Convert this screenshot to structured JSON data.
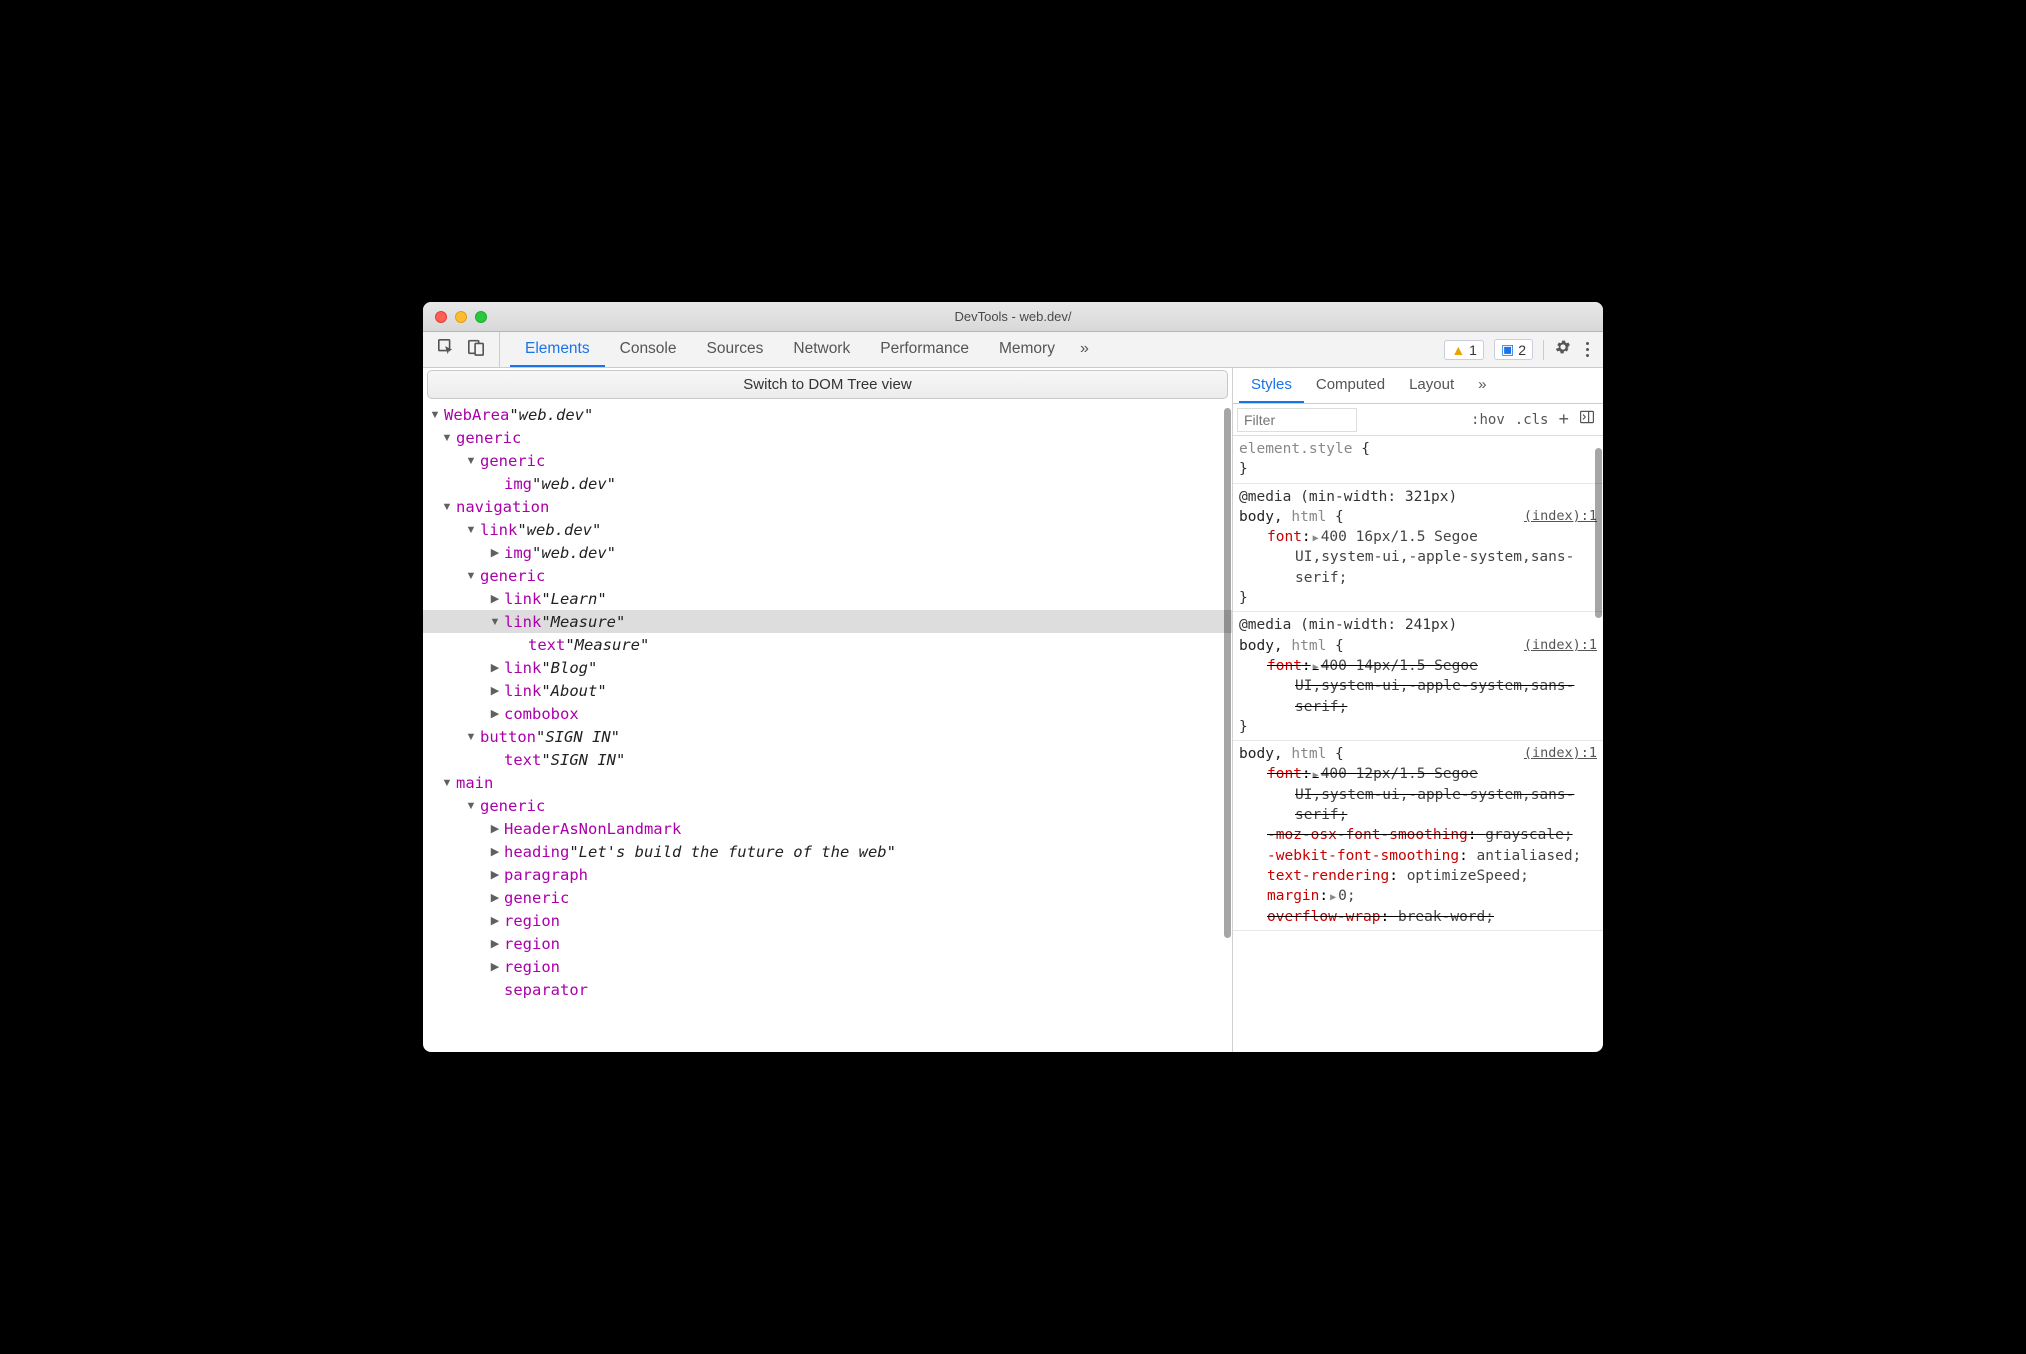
{
  "window": {
    "title": "DevTools - web.dev/"
  },
  "toolbar": {
    "tabs": [
      "Elements",
      "Console",
      "Sources",
      "Network",
      "Performance",
      "Memory"
    ],
    "more": "»",
    "warnings": "1",
    "messages": "2"
  },
  "switchBar": "Switch to DOM Tree view",
  "tree": [
    {
      "indent": 0,
      "arrow": "down",
      "role": "WebArea",
      "name": "web.dev"
    },
    {
      "indent": 1,
      "arrow": "down",
      "role": "generic"
    },
    {
      "indent": 2,
      "arrow": "down",
      "role": "generic"
    },
    {
      "indent": 3,
      "arrow": "none",
      "role": "img",
      "name": "web.dev"
    },
    {
      "indent": 1,
      "arrow": "down",
      "role": "navigation"
    },
    {
      "indent": 2,
      "arrow": "down",
      "role": "link",
      "name": "web.dev"
    },
    {
      "indent": 3,
      "arrow": "right",
      "role": "img",
      "name": "web.dev"
    },
    {
      "indent": 2,
      "arrow": "down",
      "role": "generic"
    },
    {
      "indent": 3,
      "arrow": "right",
      "role": "link",
      "name": "Learn"
    },
    {
      "indent": 3,
      "arrow": "down",
      "role": "link",
      "name": "Measure",
      "selected": true
    },
    {
      "indent": 4,
      "arrow": "none",
      "role": "text",
      "name": "Measure"
    },
    {
      "indent": 3,
      "arrow": "right",
      "role": "link",
      "name": "Blog"
    },
    {
      "indent": 3,
      "arrow": "right",
      "role": "link",
      "name": "About"
    },
    {
      "indent": 3,
      "arrow": "right",
      "role": "combobox"
    },
    {
      "indent": 2,
      "arrow": "down",
      "role": "button",
      "name": "SIGN IN"
    },
    {
      "indent": 3,
      "arrow": "none",
      "role": "text",
      "name": "SIGN IN"
    },
    {
      "indent": 1,
      "arrow": "down",
      "role": "main"
    },
    {
      "indent": 2,
      "arrow": "down",
      "role": "generic"
    },
    {
      "indent": 3,
      "arrow": "right",
      "role": "HeaderAsNonLandmark"
    },
    {
      "indent": 3,
      "arrow": "right",
      "role": "heading",
      "name": "Let's build the future of the web"
    },
    {
      "indent": 3,
      "arrow": "right",
      "role": "paragraph"
    },
    {
      "indent": 3,
      "arrow": "right",
      "role": "generic"
    },
    {
      "indent": 3,
      "arrow": "right",
      "role": "region"
    },
    {
      "indent": 3,
      "arrow": "right",
      "role": "region"
    },
    {
      "indent": 3,
      "arrow": "right",
      "role": "region"
    },
    {
      "indent": 3,
      "arrow": "none",
      "role": "separator"
    }
  ],
  "stylesTabs": {
    "items": [
      "Styles",
      "Computed",
      "Layout"
    ],
    "more": "»"
  },
  "filter": {
    "placeholder": "Filter",
    "hov": ":hov",
    "cls": ".cls"
  },
  "styles": {
    "elementStyle": {
      "selector": "element.style",
      "open": "{",
      "close": "}"
    },
    "rules": [
      {
        "media": "@media (min-width: 321px)",
        "selectorHl": "body,",
        "selectorDim": "html",
        "open": "{",
        "src": "(index):1",
        "decls": [
          {
            "prop": "font",
            "expand": true,
            "val": "400 16px/1.5 Segoe UI,system-ui,-apple-system,sans-serif;"
          }
        ],
        "close": "}"
      },
      {
        "media": "@media (min-width: 241px)",
        "selectorHl": "body,",
        "selectorDim": "html",
        "open": "{",
        "src": "(index):1",
        "decls": [
          {
            "prop": "font",
            "expand": true,
            "val": "400 14px/1.5 Segoe UI,system-ui,-apple-system,sans-serif;",
            "strike": true
          }
        ],
        "close": "}"
      },
      {
        "selectorHl": "body,",
        "selectorDim": "html",
        "open": "{",
        "src": "(index):1",
        "decls": [
          {
            "prop": "font",
            "expand": true,
            "val": "400 12px/1.5 Segoe UI,system-ui,-apple-system,sans-serif;",
            "strike": true
          },
          {
            "prop": "-moz-osx-font-smoothing",
            "val": "grayscale;",
            "strike": true
          },
          {
            "prop": "-webkit-font-smoothing",
            "val": "antialiased;"
          },
          {
            "prop": "text-rendering",
            "val": "optimizeSpeed;"
          },
          {
            "prop": "margin",
            "expand": true,
            "val": "0;"
          },
          {
            "prop": "overflow-wrap",
            "val": "break-word;",
            "strike": true,
            "cut": true
          }
        ]
      }
    ]
  }
}
